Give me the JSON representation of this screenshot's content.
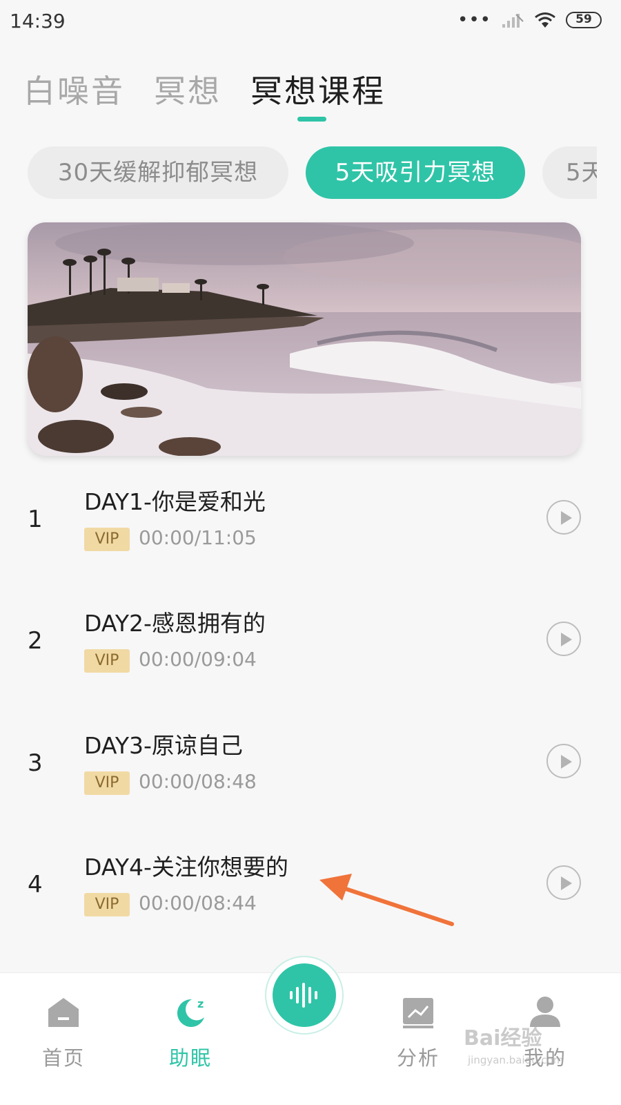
{
  "status_bar": {
    "time": "14:39",
    "dots": "•••",
    "battery": "59",
    "icons": [
      "signal-icon",
      "wifi-icon",
      "battery-icon"
    ]
  },
  "top_tabs": [
    {
      "label": "白噪音",
      "active": false
    },
    {
      "label": "冥想",
      "active": false
    },
    {
      "label": "冥想课程",
      "active": true
    }
  ],
  "course_pills": [
    {
      "label": "30天缓解抑郁冥想",
      "active": false
    },
    {
      "label": "5天吸引力冥想",
      "active": true
    },
    {
      "label": "5天",
      "active": false
    }
  ],
  "banner": {
    "icon": "seascape-image"
  },
  "tracks": [
    {
      "index": "1",
      "title": "DAY1-你是爱和光",
      "badge": "VIP",
      "time": "00:00/11:05"
    },
    {
      "index": "2",
      "title": "DAY2-感恩拥有的",
      "badge": "VIP",
      "time": "00:00/09:04"
    },
    {
      "index": "3",
      "title": "DAY3-原谅自己",
      "badge": "VIP",
      "time": "00:00/08:48"
    },
    {
      "index": "4",
      "title": "DAY4-关注你想要的",
      "badge": "VIP",
      "time": "00:00/08:44"
    }
  ],
  "bottom_nav": {
    "items": [
      {
        "label": "首页",
        "icon": "home-icon",
        "active": false
      },
      {
        "label": "助眠",
        "icon": "moon-sleep-icon",
        "active": true
      },
      {
        "label": "分析",
        "icon": "chart-icon",
        "active": false
      },
      {
        "label": "我的",
        "icon": "user-icon",
        "active": false
      }
    ],
    "center_icon": "sound-wave-icon"
  },
  "watermark": {
    "main": "Bai经验",
    "sub": "jingyan.baidu.com"
  },
  "colors": {
    "accent": "#2fc4a7",
    "vip_bg": "#f1d9a4",
    "annotation_arrow": "#f0733a"
  }
}
